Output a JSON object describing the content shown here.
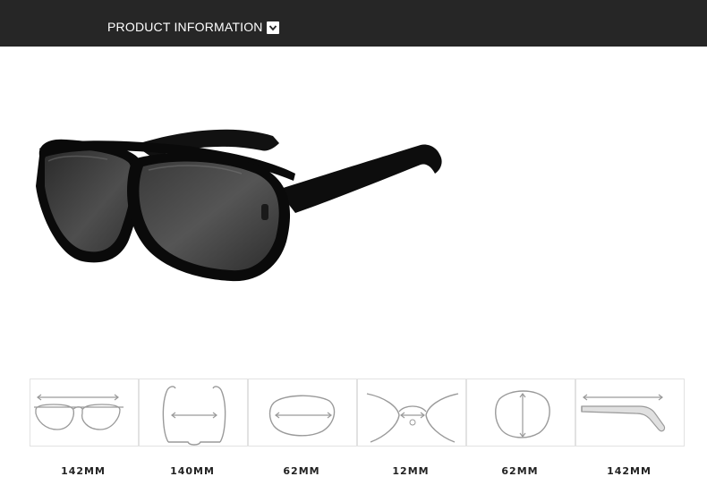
{
  "header": {
    "title": "PRODUCT INFORMATION",
    "chevron_icon": "chevron-down-icon"
  },
  "product": {
    "image_icon": "sunglasses-photo"
  },
  "dimensions": [
    {
      "label": "142MM",
      "icon": "frame-width-icon"
    },
    {
      "label": "140MM",
      "icon": "temple-span-icon"
    },
    {
      "label": "62MM",
      "icon": "lens-width-icon"
    },
    {
      "label": "12MM",
      "icon": "bridge-width-icon"
    },
    {
      "label": "62MM",
      "icon": "lens-height-icon"
    },
    {
      "label": "142MM",
      "icon": "temple-length-icon"
    }
  ],
  "colors": {
    "header_bg": "#262626",
    "diagram_stroke": "#9a9a9a"
  }
}
